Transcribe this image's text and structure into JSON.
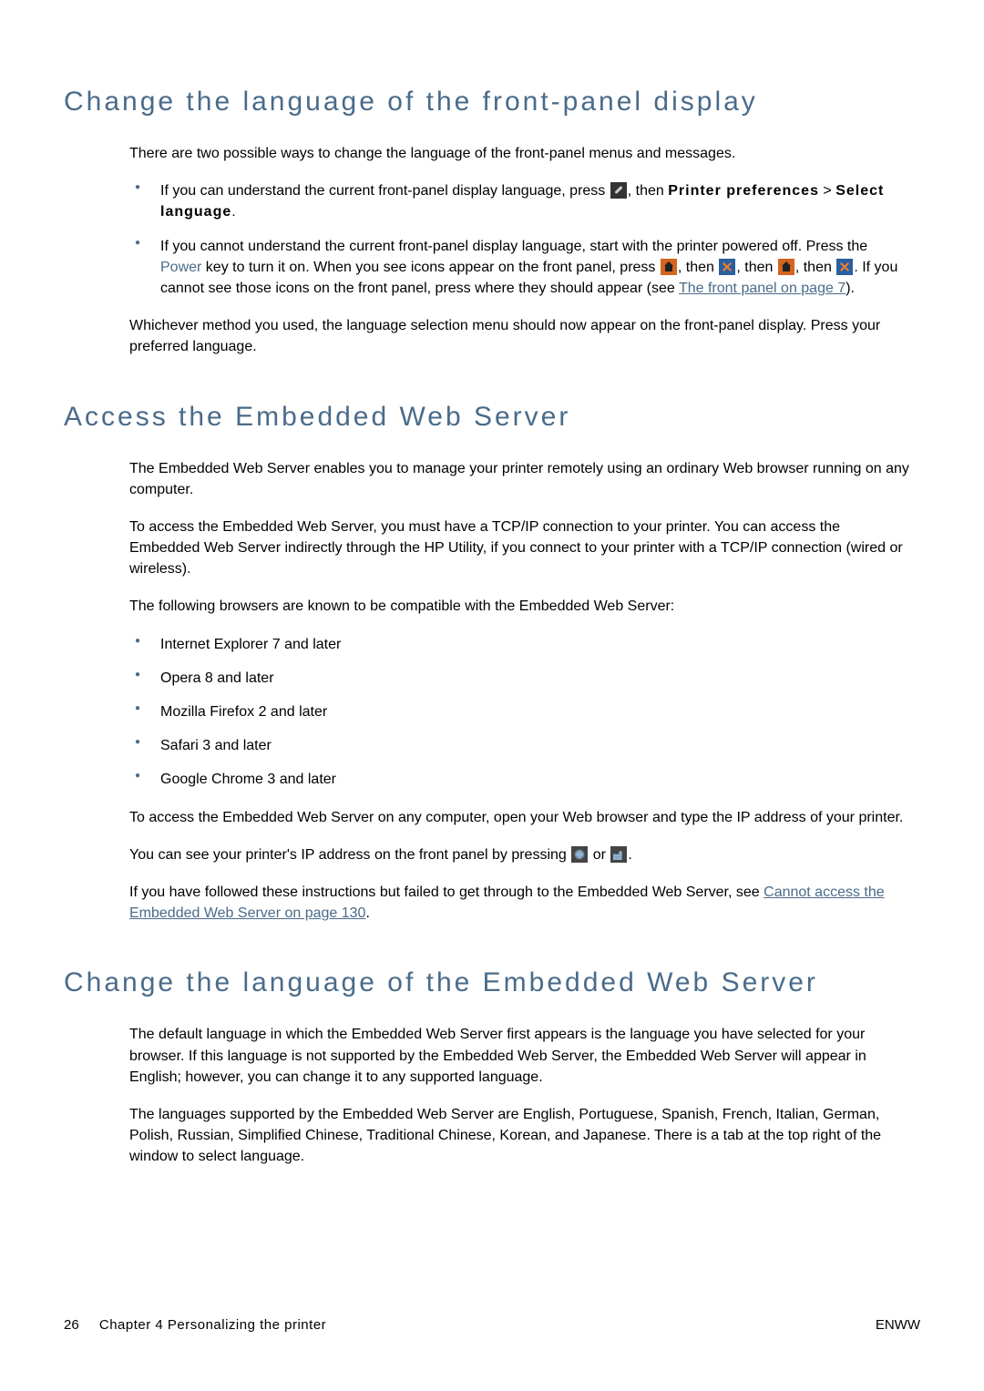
{
  "section1": {
    "heading": "Change the language of the front-panel display",
    "intro": "There are two possible ways to change the language of the front-panel menus and messages.",
    "bullet1_a": "If you can understand the current front-panel display language, press ",
    "bullet1_b": ", then ",
    "bullet1_c": "Printer preferences",
    "bullet1_d": " > ",
    "bullet1_e": "Select language",
    "bullet1_f": ".",
    "bullet2_a": "If you cannot understand the current front-panel display language, start with the printer powered off. Press the ",
    "bullet2_aa": "Power",
    "bullet2_b": " key to turn it on. When you see icons appear on the front panel, press ",
    "bullet2_c": ", then ",
    "bullet2_d": ", then ",
    "bullet2_e": ", then ",
    "bullet2_f": ". If you cannot see those icons on the front panel, press where they should appear (see ",
    "bullet2_link": "The front panel on page 7",
    "bullet2_g": ").",
    "outro": "Whichever method you used, the language selection menu should now appear on the front-panel display. Press your preferred language."
  },
  "section2": {
    "heading": "Access the Embedded Web Server",
    "p1": "The Embedded Web Server enables you to manage your printer remotely using an ordinary Web browser running on any computer.",
    "p2": "To access the Embedded Web Server, you must have a TCP/IP connection to your printer. You can access the Embedded Web Server indirectly through the HP Utility, if you connect to your printer with a TCP/IP connection (wired or wireless).",
    "p3": "The following browsers are known to be compatible with the Embedded Web Server:",
    "browsers": [
      "Internet Explorer 7 and later",
      "Opera 8 and later",
      "Mozilla Firefox 2 and later",
      "Safari 3 and later",
      "Google Chrome 3 and later"
    ],
    "p4": "To access the Embedded Web Server on any computer, open your Web browser and type the IP address of your printer.",
    "p5a": "You can see your printer's IP address on the front panel by pressing ",
    "p5b": " or ",
    "p5c": ".",
    "p6a": "If you have followed these instructions but failed to get through to the Embedded Web Server, see ",
    "p6link": "Cannot access the Embedded Web Server on page 130",
    "p6b": "."
  },
  "section3": {
    "heading": "Change the language of the Embedded Web Server",
    "p1": "The default language in which the Embedded Web Server first appears is the language you have selected for your browser. If this language is not supported by the Embedded Web Server, the Embedded Web Server will appear in English; however, you can change it to any supported language.",
    "p2": "The languages supported by the Embedded Web Server are English, Portuguese, Spanish, French, Italian, German, Polish, Russian, Simplified Chinese, Traditional Chinese, Korean, and Japanese. There is a tab at the top right of the window to select language."
  },
  "footer": {
    "pagenum": "26",
    "chapter": "Chapter 4   Personalizing the printer",
    "region": "ENWW"
  }
}
